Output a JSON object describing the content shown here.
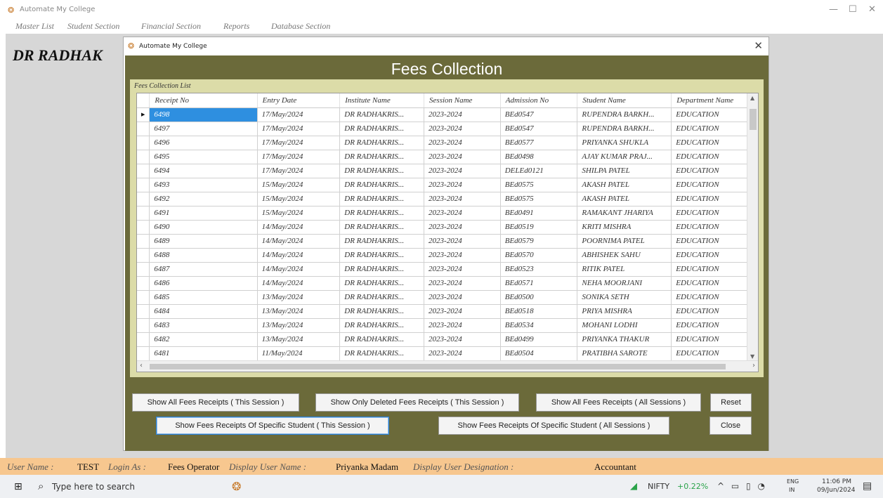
{
  "app": {
    "window_title": "Automate My College",
    "college_title": "DR RADHAK",
    "menu": [
      "Master List",
      "Student Section",
      "Financial Section",
      "Reports",
      "Database Section"
    ]
  },
  "dialog": {
    "title": "Automate My College",
    "heading": "Fees Collection",
    "group_label": "Fees Collection List",
    "columns": [
      "Receipt No",
      "Entry Date",
      "Institute Name",
      "Session Name",
      "Admission No",
      "Student Name",
      "Department Name"
    ],
    "rows": [
      [
        "6498",
        "17/May/2024",
        "DR RADHAKRIS...",
        "2023-2024",
        "BEd0547",
        "RUPENDRA BARKH...",
        "EDUCATION"
      ],
      [
        "6497",
        "17/May/2024",
        "DR RADHAKRIS...",
        "2023-2024",
        "BEd0547",
        "RUPENDRA BARKH...",
        "EDUCATION"
      ],
      [
        "6496",
        "17/May/2024",
        "DR RADHAKRIS...",
        "2023-2024",
        "BEd0577",
        "PRIYANKA SHUKLA",
        "EDUCATION"
      ],
      [
        "6495",
        "17/May/2024",
        "DR RADHAKRIS...",
        "2023-2024",
        "BEd0498",
        "AJAY KUMAR PRAJ...",
        "EDUCATION"
      ],
      [
        "6494",
        "17/May/2024",
        "DR RADHAKRIS...",
        "2023-2024",
        "DELEd0121",
        "SHILPA PATEL",
        "EDUCATION"
      ],
      [
        "6493",
        "15/May/2024",
        "DR RADHAKRIS...",
        "2023-2024",
        "BEd0575",
        "AKASH PATEL",
        "EDUCATION"
      ],
      [
        "6492",
        "15/May/2024",
        "DR RADHAKRIS...",
        "2023-2024",
        "BEd0575",
        "AKASH PATEL",
        "EDUCATION"
      ],
      [
        "6491",
        "15/May/2024",
        "DR RADHAKRIS...",
        "2023-2024",
        "BEd0491",
        "RAMAKANT JHARIYA",
        "EDUCATION"
      ],
      [
        "6490",
        "14/May/2024",
        "DR RADHAKRIS...",
        "2023-2024",
        "BEd0519",
        "KRITI MISHRA",
        "EDUCATION"
      ],
      [
        "6489",
        "14/May/2024",
        "DR RADHAKRIS...",
        "2023-2024",
        "BEd0579",
        "POORNIMA PATEL",
        "EDUCATION"
      ],
      [
        "6488",
        "14/May/2024",
        "DR RADHAKRIS...",
        "2023-2024",
        "BEd0570",
        "ABHISHEK SAHU",
        "EDUCATION"
      ],
      [
        "6487",
        "14/May/2024",
        "DR RADHAKRIS...",
        "2023-2024",
        "BEd0523",
        "RITIK PATEL",
        "EDUCATION"
      ],
      [
        "6486",
        "14/May/2024",
        "DR RADHAKRIS...",
        "2023-2024",
        "BEd0571",
        "NEHA MOORJANI",
        "EDUCATION"
      ],
      [
        "6485",
        "13/May/2024",
        "DR RADHAKRIS...",
        "2023-2024",
        "BEd0500",
        "SONIKA SETH",
        "EDUCATION"
      ],
      [
        "6484",
        "13/May/2024",
        "DR RADHAKRIS...",
        "2023-2024",
        "BEd0518",
        "PRIYA MISHRA",
        "EDUCATION"
      ],
      [
        "6483",
        "13/May/2024",
        "DR RADHAKRIS...",
        "2023-2024",
        "BEd0534",
        "MOHANI LODHI",
        "EDUCATION"
      ],
      [
        "6482",
        "13/May/2024",
        "DR RADHAKRIS...",
        "2023-2024",
        "BEd0499",
        "PRIYANKA THAKUR",
        "EDUCATION"
      ],
      [
        "6481",
        "11/May/2024",
        "DR RADHAKRIS...",
        "2023-2024",
        "BEd0504",
        "PRATIBHA SAROTE",
        "EDUCATION"
      ]
    ],
    "selected_row": 0,
    "buttons": {
      "all_this_session": "Show All Fees Receipts ( This Session )",
      "deleted_this_session": "Show Only Deleted Fees Receipts ( This Session )",
      "all_all_sessions": "Show All Fees Receipts ( All Sessions )",
      "reset": "Reset",
      "specific_this_session": "Show Fees Receipts Of Specific Student ( This Session )",
      "specific_all_sessions": "Show Fees Receipts Of Specific Student ( All Sessions )",
      "close": "Close"
    }
  },
  "status_bar": {
    "user_name_label": "User Name :",
    "user_name": "TEST",
    "login_as_label": "Login As :",
    "login_as": "Fees Operator",
    "display_name_label": "Display User Name :",
    "display_name": "Priyanka Madam",
    "designation_label": "Display User Designation :",
    "designation": "Accountant"
  },
  "taskbar": {
    "search_placeholder": "Type here to search",
    "nifty_label": "NIFTY",
    "nifty_change": "+0.22%",
    "lang_top": "ENG",
    "lang_bottom": "IN",
    "time": "11:06 PM",
    "date": "09/Jun/2024"
  },
  "colors": {
    "dialog_background": "#6b6a3a",
    "group_background": "#dcdca8",
    "status_bar": "#f7c78f",
    "selected_cell": "#2e8fe0"
  },
  "icons": [
    "app-icon",
    "minimize-icon",
    "maximize-icon",
    "close-icon",
    "row-pointer-icon",
    "windows-start-icon",
    "search-icon",
    "nifty-chart-icon",
    "chevron-up-icon",
    "notification-icon"
  ]
}
